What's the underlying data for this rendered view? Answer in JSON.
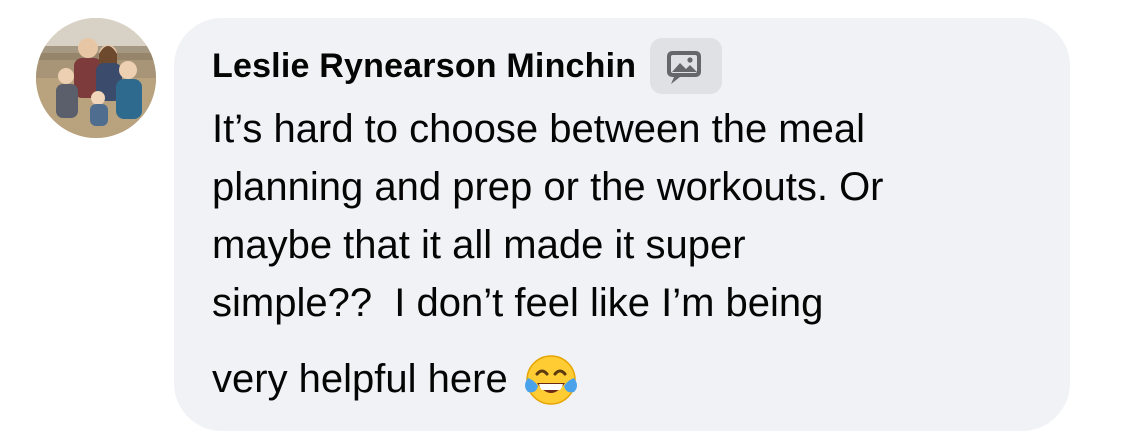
{
  "comment": {
    "author": "Leslie Rynearson Minchin",
    "badge_icon": "photo-comment-icon",
    "text_lines": "It’s hard to choose between the meal\nplanning and prep or the workouts. Or\nmaybe that it all made it super\nsimple??  I don’t feel like I’m being",
    "last_line": "very helpful here",
    "emoji": "face-with-tears-of-joy-icon"
  },
  "colors": {
    "bubble": "#f0f2f5",
    "text": "#050505",
    "badge_bg": "#dfe1e5"
  }
}
